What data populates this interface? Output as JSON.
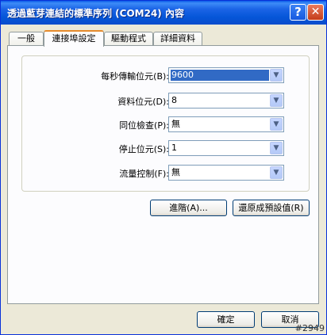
{
  "window": {
    "title": "透過藍芽連結的標準序列 (COM24) 內容",
    "help_label": "?",
    "close_label": "✕"
  },
  "tabs": [
    {
      "label": "一般"
    },
    {
      "label": "連接埠設定"
    },
    {
      "label": "驅動程式"
    },
    {
      "label": "詳細資料"
    }
  ],
  "settings": [
    {
      "label": "每秒傳輸位元(B):",
      "value": "9600"
    },
    {
      "label": "資料位元(D):",
      "value": "8"
    },
    {
      "label": "同位檢查(P):",
      "value": "無"
    },
    {
      "label": "停止位元(S):",
      "value": "1"
    },
    {
      "label": "流量控制(F):",
      "value": "無"
    }
  ],
  "buttons": {
    "advanced": "進階(A)...",
    "restore_defaults": "還原成預設值(R)",
    "ok": "確定",
    "cancel": "取消"
  },
  "watermark": "#2949"
}
